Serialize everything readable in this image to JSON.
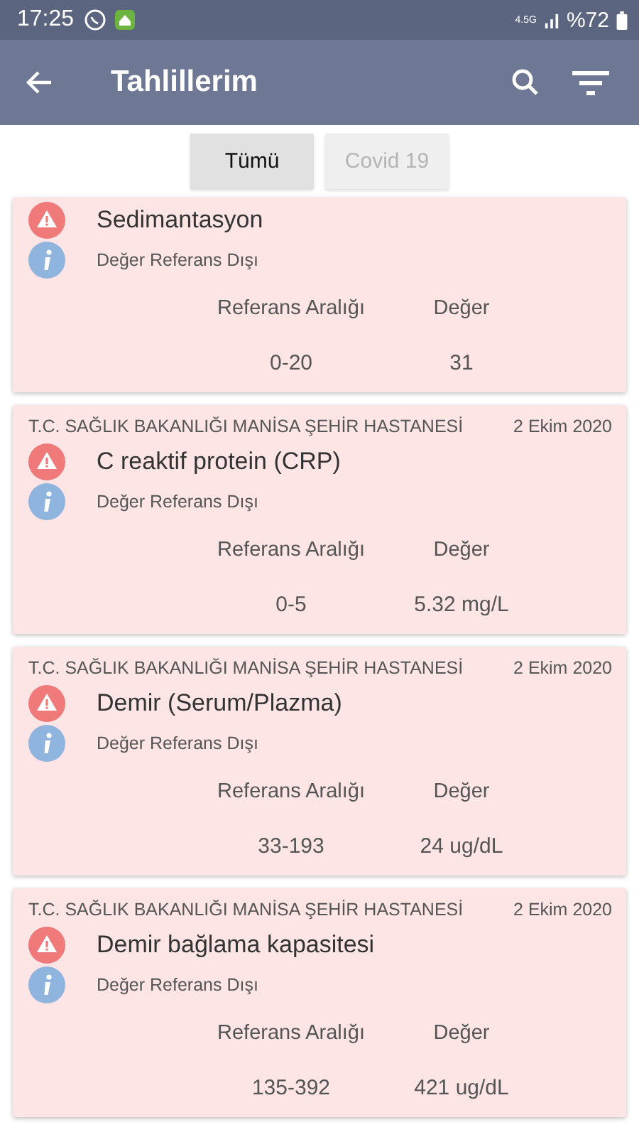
{
  "status_bar": {
    "time": "17:25",
    "network": "4.5G",
    "battery": "%72"
  },
  "app_bar": {
    "title": "Tahlillerim"
  },
  "tabs": [
    {
      "label": "Tümü",
      "selected": true
    },
    {
      "label": "Covid 19",
      "selected": false
    }
  ],
  "results": [
    {
      "test": "Sedimantasyon",
      "note": "Değer Referans Dışı",
      "range_label": "Referans Aralığı",
      "value_label": "Değer",
      "range": "0-20",
      "value": "31"
    },
    {
      "hospital": "T.C. SAĞLIK BAKANLIĞI MANİSA ŞEHİR HASTANESİ",
      "date": "2 Ekim 2020",
      "test": "C reaktif protein (CRP)",
      "note": "Değer Referans Dışı",
      "range_label": "Referans Aralığı",
      "value_label": "Değer",
      "range": "0-5",
      "value": "5.32 mg/L"
    },
    {
      "hospital": "T.C. SAĞLIK BAKANLIĞI MANİSA ŞEHİR HASTANESİ",
      "date": "2 Ekim 2020",
      "test": "Demir (Serum/Plazma)",
      "note": "Değer Referans Dışı",
      "range_label": "Referans Aralığı",
      "value_label": "Değer",
      "range": "33-193",
      "value": "24 ug/dL"
    },
    {
      "hospital": "T.C. SAĞLIK BAKANLIĞI MANİSA ŞEHİR HASTANESİ",
      "date": "2 Ekim 2020",
      "test": "Demir bağlama kapasitesi",
      "note": "Değer Referans Dışı",
      "range_label": "Referans Aralığı",
      "value_label": "Değer",
      "range": "135-392",
      "value": "421 ug/dL"
    }
  ]
}
